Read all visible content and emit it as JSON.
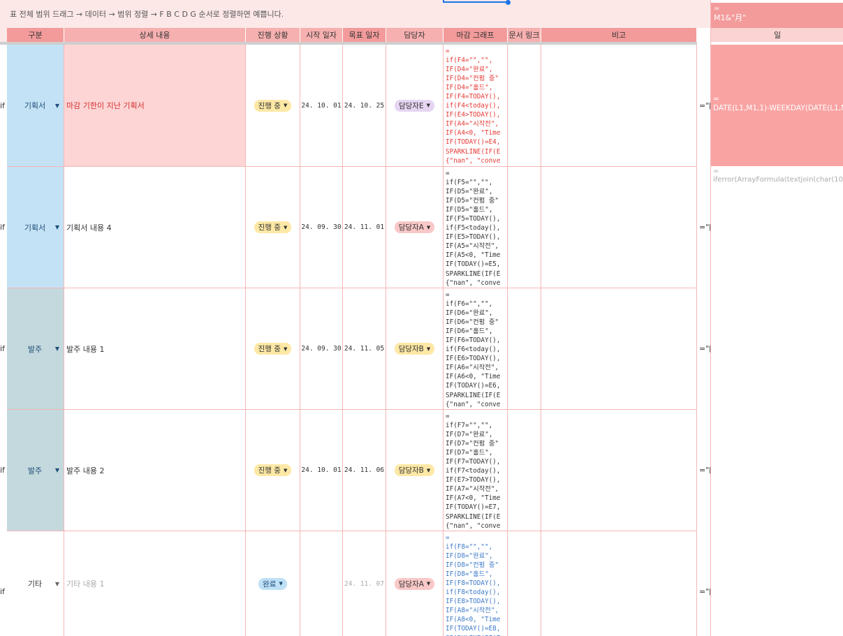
{
  "instruction": "표 전체 범위 드래그 → 데이터 → 범위 정렬 → F B C D G 순서로 정렬하면 예쁩니다.",
  "headers": {
    "category": "구분",
    "detail": "상세 내용",
    "status": "진행 상황",
    "start": "시작 일자",
    "target": "목표 일자",
    "owner": "담당자",
    "graph": "마감 그래프",
    "link": "문서 링크",
    "note": "비고"
  },
  "left_prefix": "if",
  "extra_col_value": "=\"[",
  "right_pane": {
    "top_eq": "=",
    "top_formula": "M1&\"月\"",
    "day_header": "일",
    "big_eq": "=",
    "big_formula": "DATE(L1,M1,1)-WEEKDAY(DATE(L1,M",
    "note_eq": "=",
    "note_formula": "iferror(ArrayFormula(textjoin(char(10),"
  },
  "rows": [
    {
      "category": "기획서",
      "detail": "마감 기한이 지난 기획서",
      "status": "진행 중",
      "start": "24. 10. 01",
      "target": "24. 10. 25",
      "owner": "담당자E",
      "formula": "=\nif(F4=\"\",\"\",\nIF(D4=\"완료\", \nIF(D4=\"컨펌 중\"\nIF(D4=\"홀드\", \nIF(F4=TODAY(),\nif(F4<today(),\nIF(E4>TODAY(),\nIF(A4=\"시작전\",\nIF(A4<0, \"Time\nIF(TODAY()=E4,\nSPARKLINE(IF(E\n{\"nan\", \"conve"
    },
    {
      "category": "기획서",
      "detail": "기획서 내용 4",
      "status": "진행 중",
      "start": "24. 09. 30",
      "target": "24. 11. 01",
      "owner": "담당자A",
      "formula": "=\nif(F5=\"\",\"\",\nIF(D5=\"완료\", \nIF(D5=\"컨펌 중\"\nIF(D5=\"홀드\", \nIF(F5=TODAY(),\nif(F5<today(),\nIF(E5>TODAY(),\nIF(A5=\"시작전\",\nIF(A5<0, \"Time\nIF(TODAY()=E5,\nSPARKLINE(IF(E\n{\"nan\", \"conve"
    },
    {
      "category": "발주",
      "detail": "발주 내용 1",
      "status": "진행 중",
      "start": "24. 09. 30",
      "target": "24. 11. 05",
      "owner": "담당자B",
      "formula": "=\nif(F6=\"\",\"\",\nIF(D6=\"완료\", \nIF(D6=\"컨펌 중\"\nIF(D6=\"홀드\", \nIF(F6=TODAY(),\nif(F6<today(),\nIF(E6>TODAY(),\nIF(A6=\"시작전\",\nIF(A6<0, \"Time\nIF(TODAY()=E6,\nSPARKLINE(IF(E\n{\"nan\", \"conve"
    },
    {
      "category": "발주",
      "detail": "발주 내용 2",
      "status": "진행 중",
      "start": "24. 10. 01",
      "target": "24. 11. 06",
      "owner": "담당자B",
      "formula": "=\nif(F7=\"\",\"\",\nIF(D7=\"완료\", \nIF(D7=\"컨펌 중\"\nIF(D7=\"홀드\", \nIF(F7=TODAY(),\nif(F7<today(),\nIF(E7>TODAY(),\nIF(A7=\"시작전\",\nIF(A7<0, \"Time\nIF(TODAY()=E7,\nSPARKLINE(IF(E\n{\"nan\", \"conve"
    },
    {
      "category": "기타",
      "detail": "기타 내용 1",
      "status": "완료",
      "start": "",
      "target": "24. 11. 07",
      "owner": "담당자A",
      "formula": "=\nif(F8=\"\",\"\",\nIF(D8=\"완료\", \nIF(D8=\"컨펌 중\"\nIF(D8=\"홀드\", \nIF(F8=TODAY(),\nif(F8<today(),\nIF(E8>TODAY(),\nIF(A8=\"시작전\",\nIF(A8<0, \"Time\nIF(TODAY()=E8,\nSPARKLINE(IF(E"
    }
  ],
  "colors": {
    "header_bg": "#f7b0b0",
    "category_plan_bg": "#c4e2f5",
    "category_order_bg": "#c3d9dd",
    "overdue_row_bg": "#fdd5d5",
    "overdue_text": "#d32f2f",
    "status_inprogress_bg": "#fde8a5",
    "status_done_bg": "#bfe0f6",
    "owner_A_bg": "#f9c8c8",
    "owner_B_bg": "#fde8a5",
    "owner_E_bg": "#e6d5f2",
    "formula_red": "#e53935",
    "formula_blue": "#3d7ac9"
  }
}
